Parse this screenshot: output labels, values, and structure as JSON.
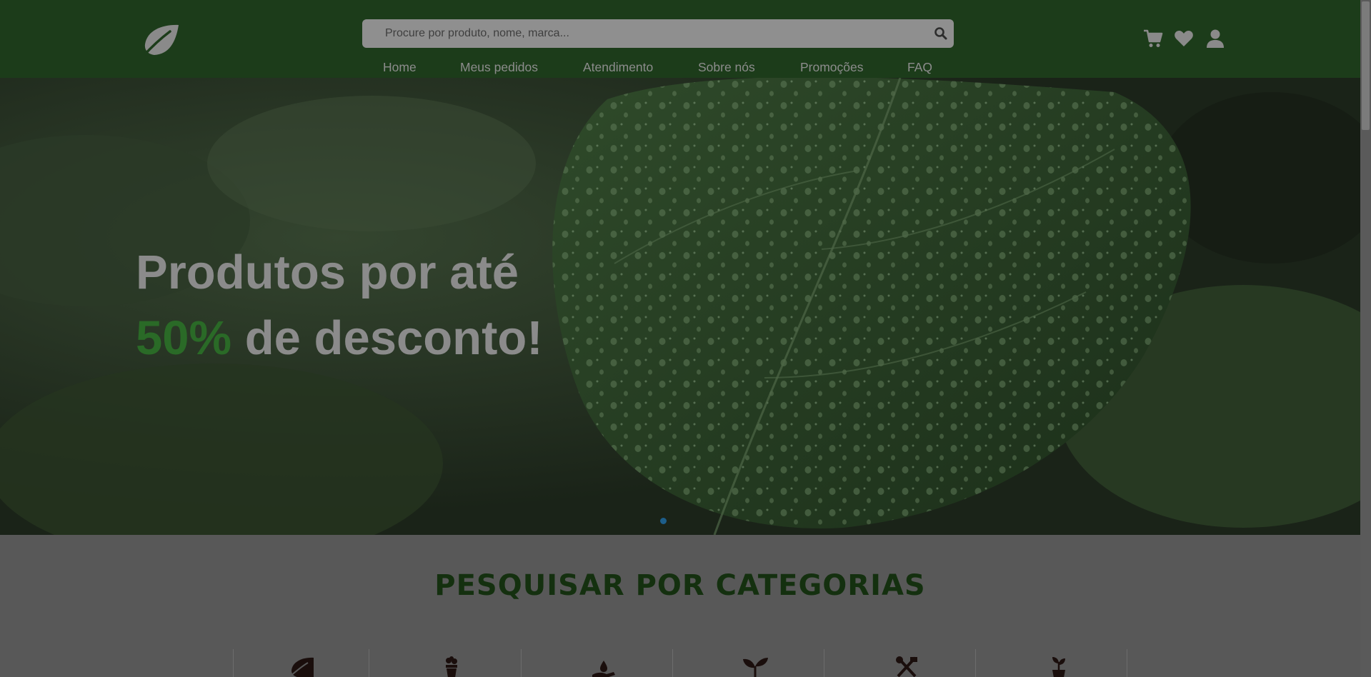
{
  "search": {
    "placeholder": "Procure por produto, nome, marca..."
  },
  "nav": [
    "Home",
    "Meus pedidos",
    "Atendimento",
    "Sobre nós",
    "Promoções",
    "FAQ"
  ],
  "hero": {
    "line1": "Produtos por até",
    "accent": "50%",
    "line2_rest": " de desconto!"
  },
  "categories": {
    "title": "PESQUISAR POR CATEGORIAS"
  },
  "colors": {
    "header": "#1c3c1a",
    "accent": "#2a6a27",
    "category_title": "#14300f"
  },
  "icons": {
    "logo": "leaf-icon",
    "search": "search-icon",
    "cart": "cart-icon",
    "wishlist": "heart-icon",
    "account": "user-icon",
    "categories": [
      "leaf-icon",
      "potted-plant-icon",
      "watering-icon",
      "sprout-icon",
      "garden-tools-icon",
      "seedling-pot-icon"
    ]
  }
}
